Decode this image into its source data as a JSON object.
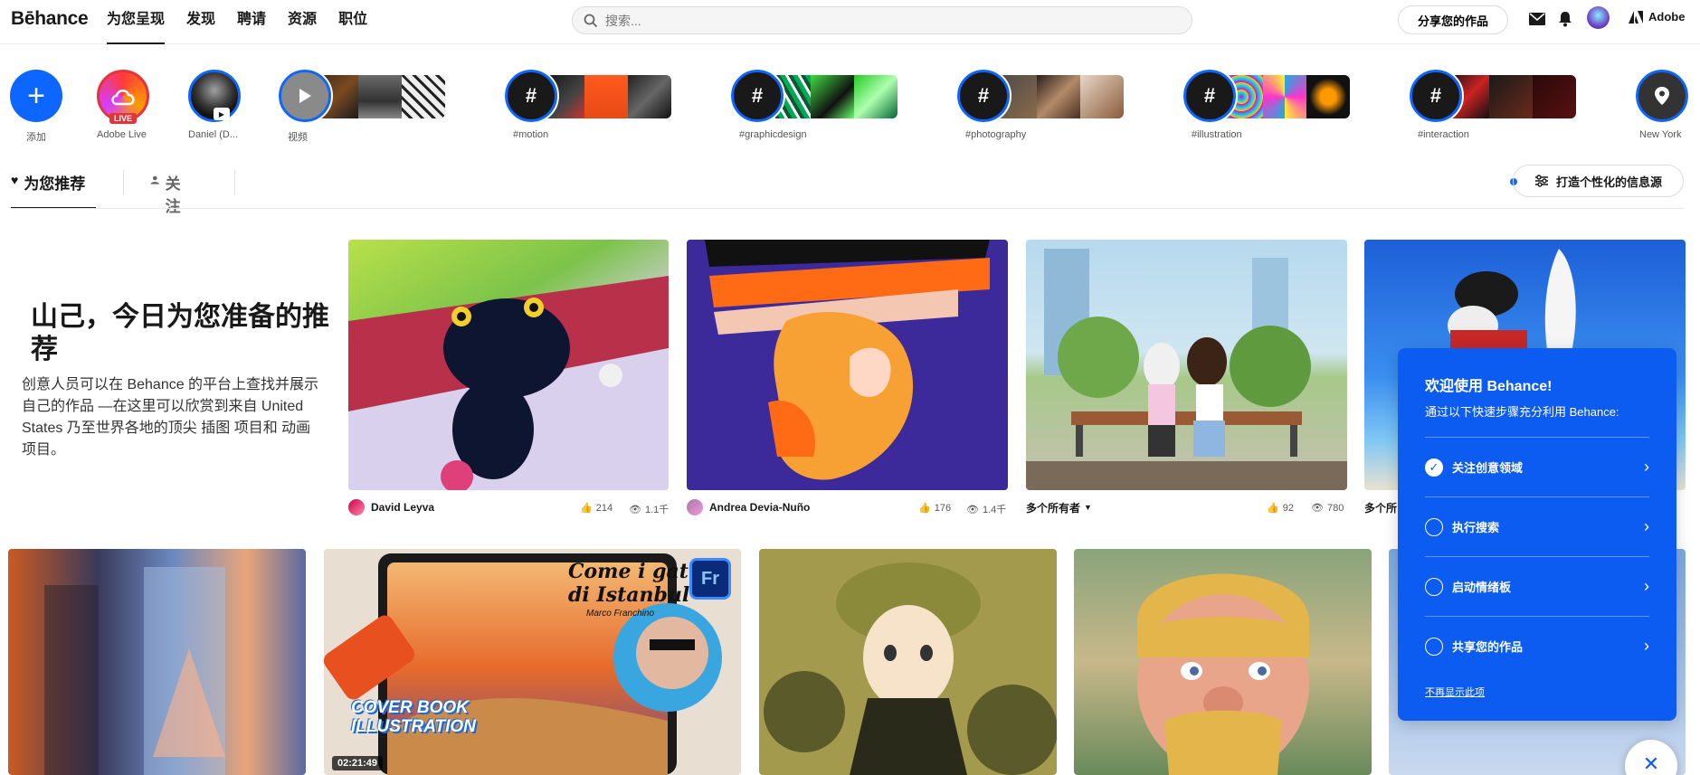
{
  "header": {
    "logo": "Bēhance",
    "nav": [
      "为您呈现",
      "发现",
      "聘请",
      "资源",
      "职位"
    ],
    "search_placeholder": "搜索...",
    "share_label": "分享您的作品",
    "adobe_label": "Adobe"
  },
  "stories": {
    "add_label": "添加",
    "live_badge": "LIVE",
    "items": [
      "Adobe Live",
      "Daniel (D...",
      "视频",
      "#motion",
      "#graphicdesign",
      "#photography",
      "#illustration",
      "#interaction",
      "New York"
    ]
  },
  "tabs": {
    "recommended": "为您推荐",
    "following": "关注",
    "personalize": "打造个性化的信息源"
  },
  "intro": {
    "title": "山己，今日为您准备的推荐",
    "body": "创意人员可以在 Behance 的平台上查找并展示自己的作品 —在这里可以欣赏到来自 United States 乃至世界各地的顶尖 插图 项目和 动画 项目。"
  },
  "cards_row1": [
    {
      "owner": "David Leyva",
      "likes": "214",
      "views": "1.1千"
    },
    {
      "owner": "Andrea Devia-Nuño",
      "likes": "176",
      "views": "1.4千"
    },
    {
      "owner": "多个所有者",
      "likes": "92",
      "views": "780"
    },
    {
      "owner": "多个所"
    }
  ],
  "cards_row2": {
    "cover_title": "Come i gatti di Istanbul",
    "cover_author": "Marco Franchino",
    "cover_badge": "Fr",
    "cover_caption_line1": "COVER BOOK",
    "cover_caption_line2": "ILLUSTRATION",
    "duration": "02:21:49"
  },
  "onboarding": {
    "title": "欢迎使用 Behance!",
    "subtitle": "通过以下快速步骤充分利用 Behance:",
    "steps": [
      {
        "label": "关注创意领域",
        "done": true
      },
      {
        "label": "执行搜索",
        "done": false
      },
      {
        "label": "启动情绪板",
        "done": false
      },
      {
        "label": "共享您的作品",
        "done": false
      }
    ],
    "dismiss": "不再显示此项",
    "close": "✕"
  },
  "colors": {
    "accent": "#0d66ff",
    "panel": "#0d5cf2",
    "text": "#191919"
  }
}
